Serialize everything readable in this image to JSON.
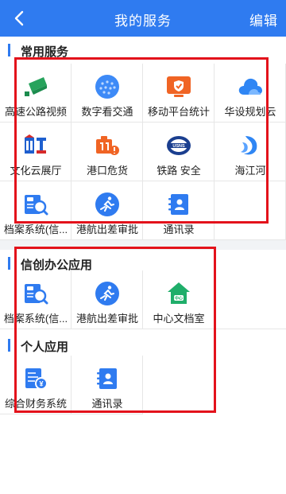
{
  "header": {
    "title": "我的服务",
    "edit_label": "编辑"
  },
  "sections": {
    "common": {
      "title": "常用服务",
      "items": [
        {
          "label": "高速公路视频",
          "icon": "camera-icon"
        },
        {
          "label": "数字看交通",
          "icon": "dots-globe-icon"
        },
        {
          "label": "移动平台统计",
          "icon": "shield-monitor-icon"
        },
        {
          "label": "华设规划云",
          "icon": "cloud-icon"
        },
        {
          "label": "文化云展厅",
          "icon": "culture-hall-icon"
        },
        {
          "label": "港口危货",
          "icon": "hazard-cargo-icon"
        },
        {
          "label": "铁路 安全",
          "icon": "railway-logo-icon"
        },
        {
          "label": "海江河",
          "icon": "wave-icon"
        },
        {
          "label": "档案系统(信...",
          "icon": "archive-search-icon"
        },
        {
          "label": "港航出差审批",
          "icon": "runner-approval-icon"
        },
        {
          "label": "通讯录",
          "icon": "contacts-icon"
        }
      ]
    },
    "xinchuang": {
      "title": "信创办公应用",
      "items": [
        {
          "label": "档案系统(信...",
          "icon": "archive-search-icon"
        },
        {
          "label": "港航出差审批",
          "icon": "runner-approval-icon"
        },
        {
          "label": "中心文档室",
          "icon": "house-folder-icon"
        }
      ]
    },
    "personal": {
      "title": "个人应用",
      "items": [
        {
          "label": "综合财务系统",
          "icon": "finance-doc-icon"
        },
        {
          "label": "通讯录",
          "icon": "contacts-icon"
        }
      ]
    }
  },
  "colors": {
    "header": "#2f7bf0",
    "accent": "#2f7bf0",
    "highlight_box": "#e3121b"
  }
}
